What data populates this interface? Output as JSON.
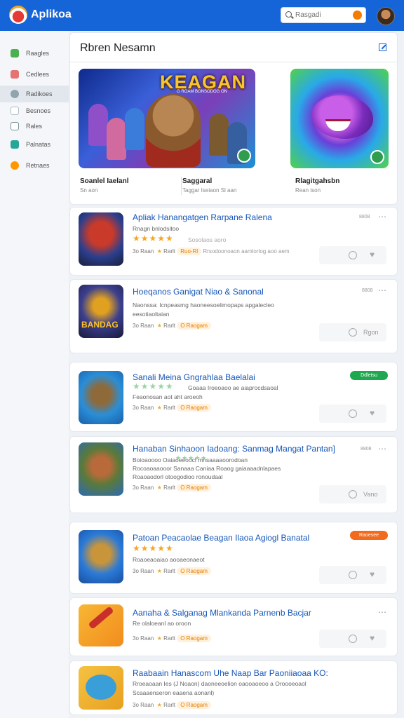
{
  "header": {
    "app_title": "Aplikoa",
    "search_placeholder": "Rasgadi"
  },
  "sidebar": {
    "items": [
      {
        "label": "Raagles",
        "color": "#4caf50"
      },
      {
        "label": "Cedlees",
        "color": "#e57373"
      },
      {
        "label": "Radikoes",
        "color": "#90a4ae"
      },
      {
        "label": "Besnoes",
        "color": "#b0bec5"
      },
      {
        "label": "Rales",
        "color": "#78909c"
      },
      {
        "label": "Palnatas",
        "color": "#26a69a"
      },
      {
        "label": "Retnaes",
        "color": "#ff9800"
      }
    ]
  },
  "featured": {
    "title": "Rbren Nesamn",
    "items": [
      {
        "name": "Soanlel Iaelanl",
        "sub": "Sn aon",
        "art_text": "KEAGAN",
        "art_sub": "G ROAM BONSODOG ON"
      },
      {
        "name": "Saggaral",
        "sub": "Taggar Iseiaon Sl aan"
      },
      {
        "name": "Rlagitgahsbn",
        "sub": "Rean ison"
      }
    ]
  },
  "apps": [
    {
      "name": "Apliak Hanangatgen Rarpane Ralena",
      "desc": "Rnagn bnlodsitoo",
      "stars": "★★★★★",
      "rating_text": "Sosolaos aoro",
      "installs": "3o Raan",
      "rating_label": "Rarlt",
      "pill": "Ruo-Rl",
      "extra": "Rrsodoonoaon aamlorlog aoo aem",
      "date": "8808",
      "action": "",
      "art_text": ""
    },
    {
      "name": "Hoeqanos Ganigat Niao & Sanonal",
      "desc": "Naonssa: Icnpeasmg haoneesoelimopaps apgalecleo",
      "desc2": "eesotiaoltaian",
      "stars": "",
      "rating_text": "",
      "installs": "3o Raan",
      "rating_label": "Rarlt",
      "pill": "O Raogam",
      "extra": "",
      "date": "8808",
      "action": "Rgon",
      "art_text": "BANDAG"
    },
    {
      "name": "Sanali Meina Gngrahlaa Baelalai",
      "desc": "Feaonosan aot aht aroeoh",
      "stars": "★★★★★",
      "rating_text": "Goaaa Iroeoaoo ae aiaprocdsaoal",
      "installs": "3o Raan",
      "rating_label": "Rarlt",
      "pill": "O Raogam",
      "extra": "",
      "date": "",
      "action": "",
      "tag": "Ddletsu",
      "art_text": ""
    },
    {
      "name": "Hanaban Sinhaoon Iadoang: Sanmag Mangat Pantan]",
      "desc": "Boioaoooo Oaiaoeeoocl mnsaaaaoorodoan",
      "desc2": "Rocoaoaaooor Sanaaa Caniaa Roaog gaiaaaadnlapaes",
      "desc3": "Roaoaodorl otoogodioo ronoudaal",
      "stars": "★★★★★",
      "rating_text": "",
      "installs": "3o Raan",
      "rating_label": "Rarlt",
      "pill": "O Raogam",
      "extra": "",
      "date": "8808",
      "action": "Vano",
      "art_text": ""
    },
    {
      "name": "Patoan Peacaolae Beagan Ilaoa Agiogl Banatal",
      "desc": "Roaoeaoaiao aooaeonaeot",
      "stars": "★★★★★",
      "rating_text": "",
      "installs": "3o Raan",
      "rating_label": "Rarlt",
      "pill": "O Raogam",
      "extra": "",
      "date": "",
      "action": "",
      "tag": "Raoesee",
      "art_text": ""
    },
    {
      "name": "Aanaha & Salganag Mlankanda Parnenb Bacjar",
      "desc": "Re olaloeanl ao oroon",
      "stars": "",
      "rating_text": "",
      "installs": "3o Raan",
      "rating_label": "Rarlt",
      "pill": "O Raogam",
      "extra": "",
      "date": "",
      "action": "",
      "art_text": ""
    },
    {
      "name": "Raabaain Hanascom Uhe Naap Bar Paoniiaoaa KO:",
      "desc": "Rroeaoaan Ies (J Noaon) daoneeoelion oaooaoeoo a Oroooeoaol",
      "desc2": "Scaaaenseron eaaena aonanl)",
      "stars": "",
      "rating_text": "",
      "installs": "3o Raan",
      "rating_label": "Rarlt",
      "pill": "O Raogam",
      "extra": "",
      "date": "",
      "action": "",
      "art_text": ""
    }
  ]
}
